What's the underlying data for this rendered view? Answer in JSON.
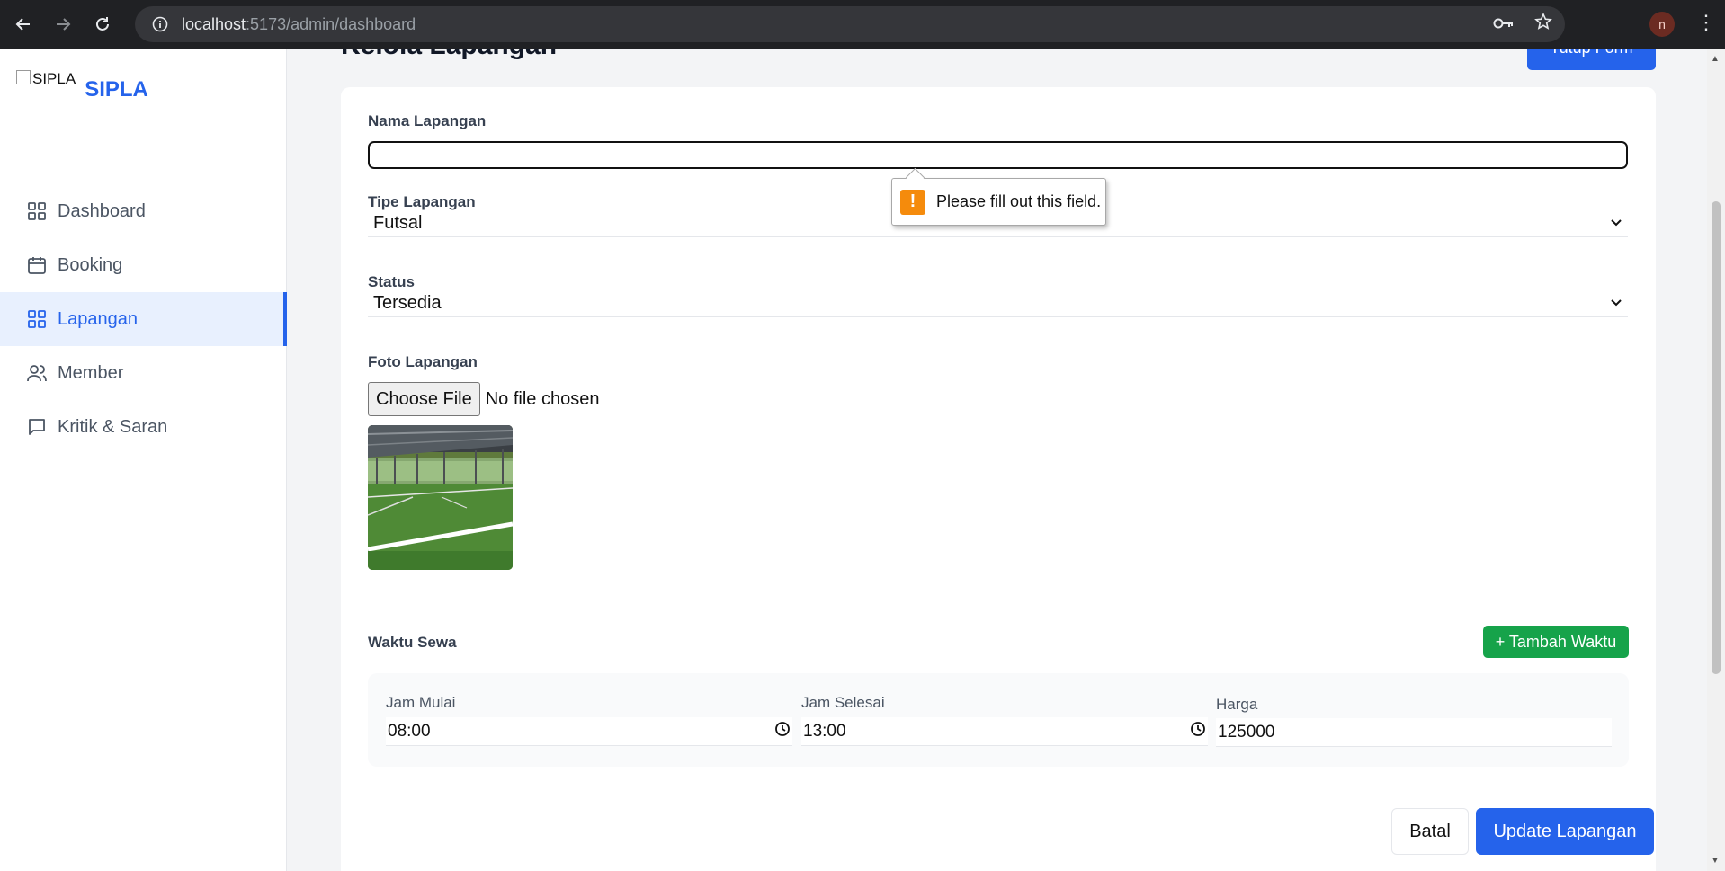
{
  "browser": {
    "url_host": "localhost",
    "url_path": ":5173/admin/dashboard",
    "profile_initial": "n"
  },
  "brand": {
    "logo_alt": "SIPLA",
    "name": "SIPLA"
  },
  "sidebar": {
    "items": [
      {
        "label": "Dashboard",
        "icon": "grid-icon",
        "active": false
      },
      {
        "label": "Booking",
        "icon": "calendar-icon",
        "active": false
      },
      {
        "label": "Lapangan",
        "icon": "grid-icon",
        "active": true
      },
      {
        "label": "Member",
        "icon": "users-icon",
        "active": false
      },
      {
        "label": "Kritik & Saran",
        "icon": "message-icon",
        "active": false
      }
    ]
  },
  "page": {
    "title": "Kelola Lapangan",
    "close_form_label": "Tutup Form"
  },
  "form": {
    "name_label": "Nama Lapangan",
    "name_value": "",
    "type_label": "Tipe Lapangan",
    "type_value": "Futsal",
    "status_label": "Status",
    "status_value": "Tersedia",
    "photo_label": "Foto Lapangan",
    "choose_file_label": "Choose File",
    "file_status": "No file chosen",
    "rental_time_label": "Waktu Sewa",
    "add_time_label": "+ Tambah Waktu",
    "slot": {
      "start_label": "Jam Mulai",
      "start_value": "08:00",
      "end_label": "Jam Selesai",
      "end_value": "13:00",
      "price_label": "Harga",
      "price_value": "125000"
    },
    "cancel_label": "Batal",
    "submit_label": "Update Lapangan"
  },
  "validation_tooltip": {
    "message": "Please fill out this field."
  },
  "colors": {
    "primary": "#2563eb",
    "success": "#16a34a",
    "warning": "#f58b0c"
  }
}
